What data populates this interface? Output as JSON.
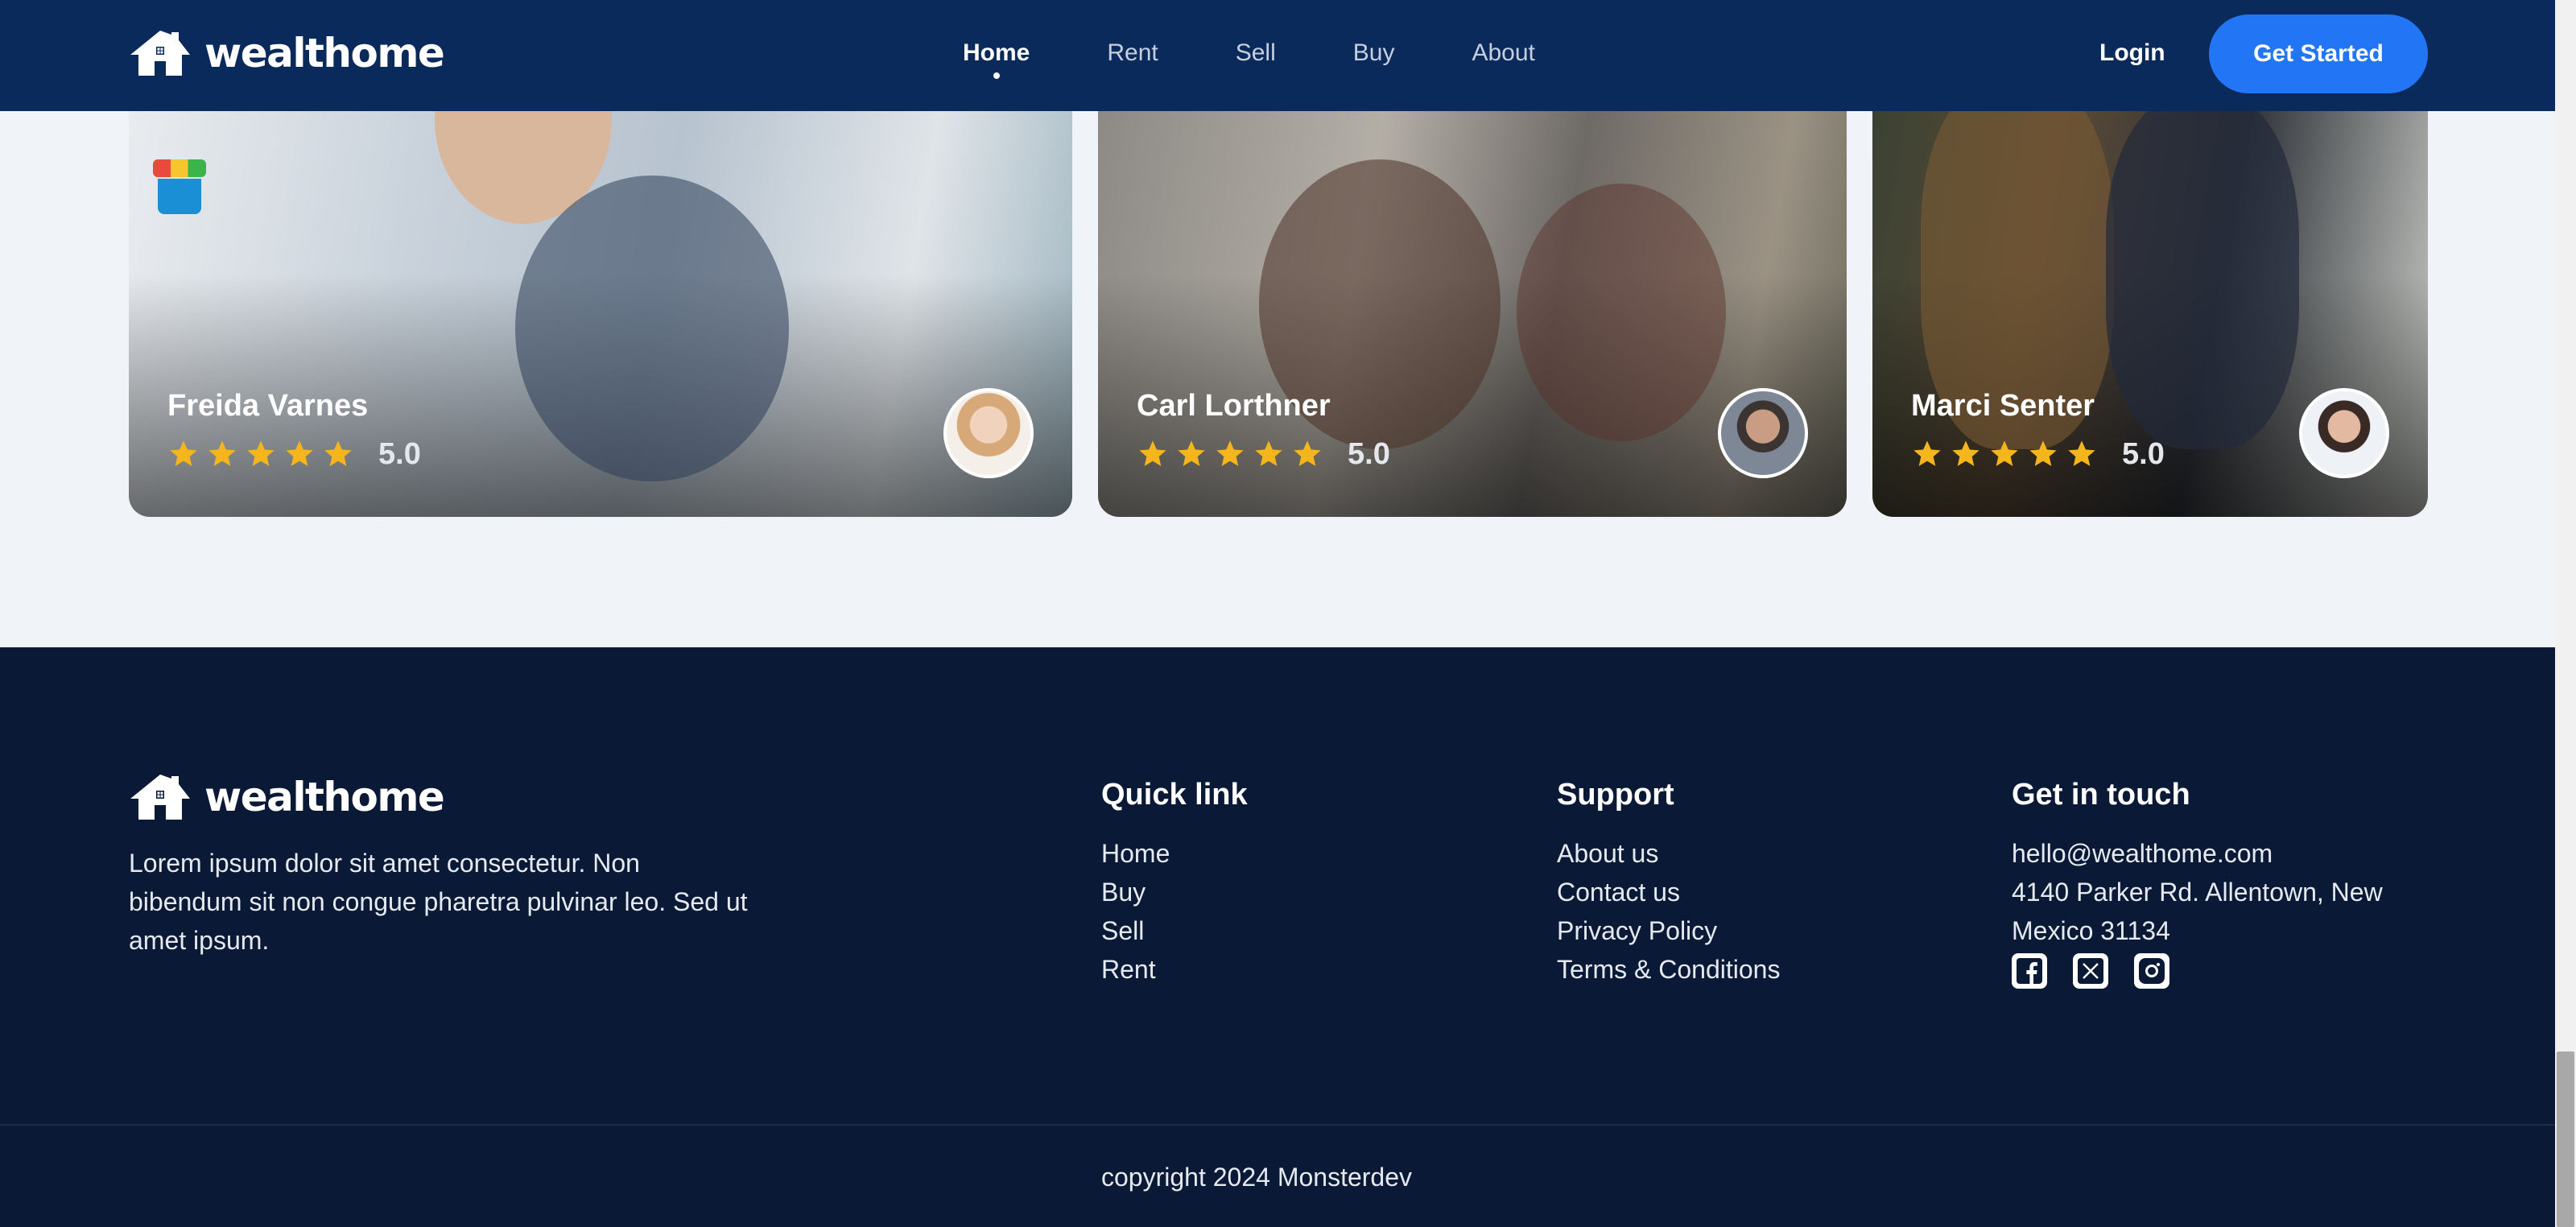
{
  "brand": {
    "name": "wealthome",
    "icon": "house-logo-icon"
  },
  "nav": {
    "items": [
      {
        "label": "Home",
        "active": true
      },
      {
        "label": "Rent",
        "active": false
      },
      {
        "label": "Sell",
        "active": false
      },
      {
        "label": "Buy",
        "active": false
      },
      {
        "label": "About",
        "active": false
      }
    ],
    "login_label": "Login",
    "cta_label": "Get Started"
  },
  "testimonials": [
    {
      "name": "Freida Varnes",
      "rating_value": 5,
      "rating_label": "5.0"
    },
    {
      "name": "Carl Lorthner",
      "rating_value": 5,
      "rating_label": "5.0"
    },
    {
      "name": "Marci Senter",
      "rating_value": 5,
      "rating_label": "5.0"
    }
  ],
  "footer": {
    "description": "Lorem ipsum dolor sit amet consectetur. Non bibendum sit non congue pharetra pulvinar leo. Sed ut amet ipsum.",
    "quick_link": {
      "title": "Quick link",
      "links": [
        "Home",
        "Buy",
        "Sell",
        "Rent"
      ]
    },
    "support": {
      "title": "Support",
      "links": [
        "About us",
        "Contact us",
        "Privacy Policy",
        "Terms & Conditions"
      ]
    },
    "contact": {
      "title": "Get in touch",
      "email": "hello@wealthome.com",
      "address": "4140 Parker Rd. Allentown, New Mexico 31134",
      "socials": [
        "facebook-icon",
        "x-twitter-icon",
        "instagram-icon"
      ]
    },
    "copyright": "copyright 2024 Monsterdev"
  },
  "colors": {
    "header_bg": "#0b2a5c",
    "footer_bg": "#0a1a36",
    "accent": "#2276f5",
    "star": "#f5b51c",
    "page_bg": "#f0f4f9"
  }
}
